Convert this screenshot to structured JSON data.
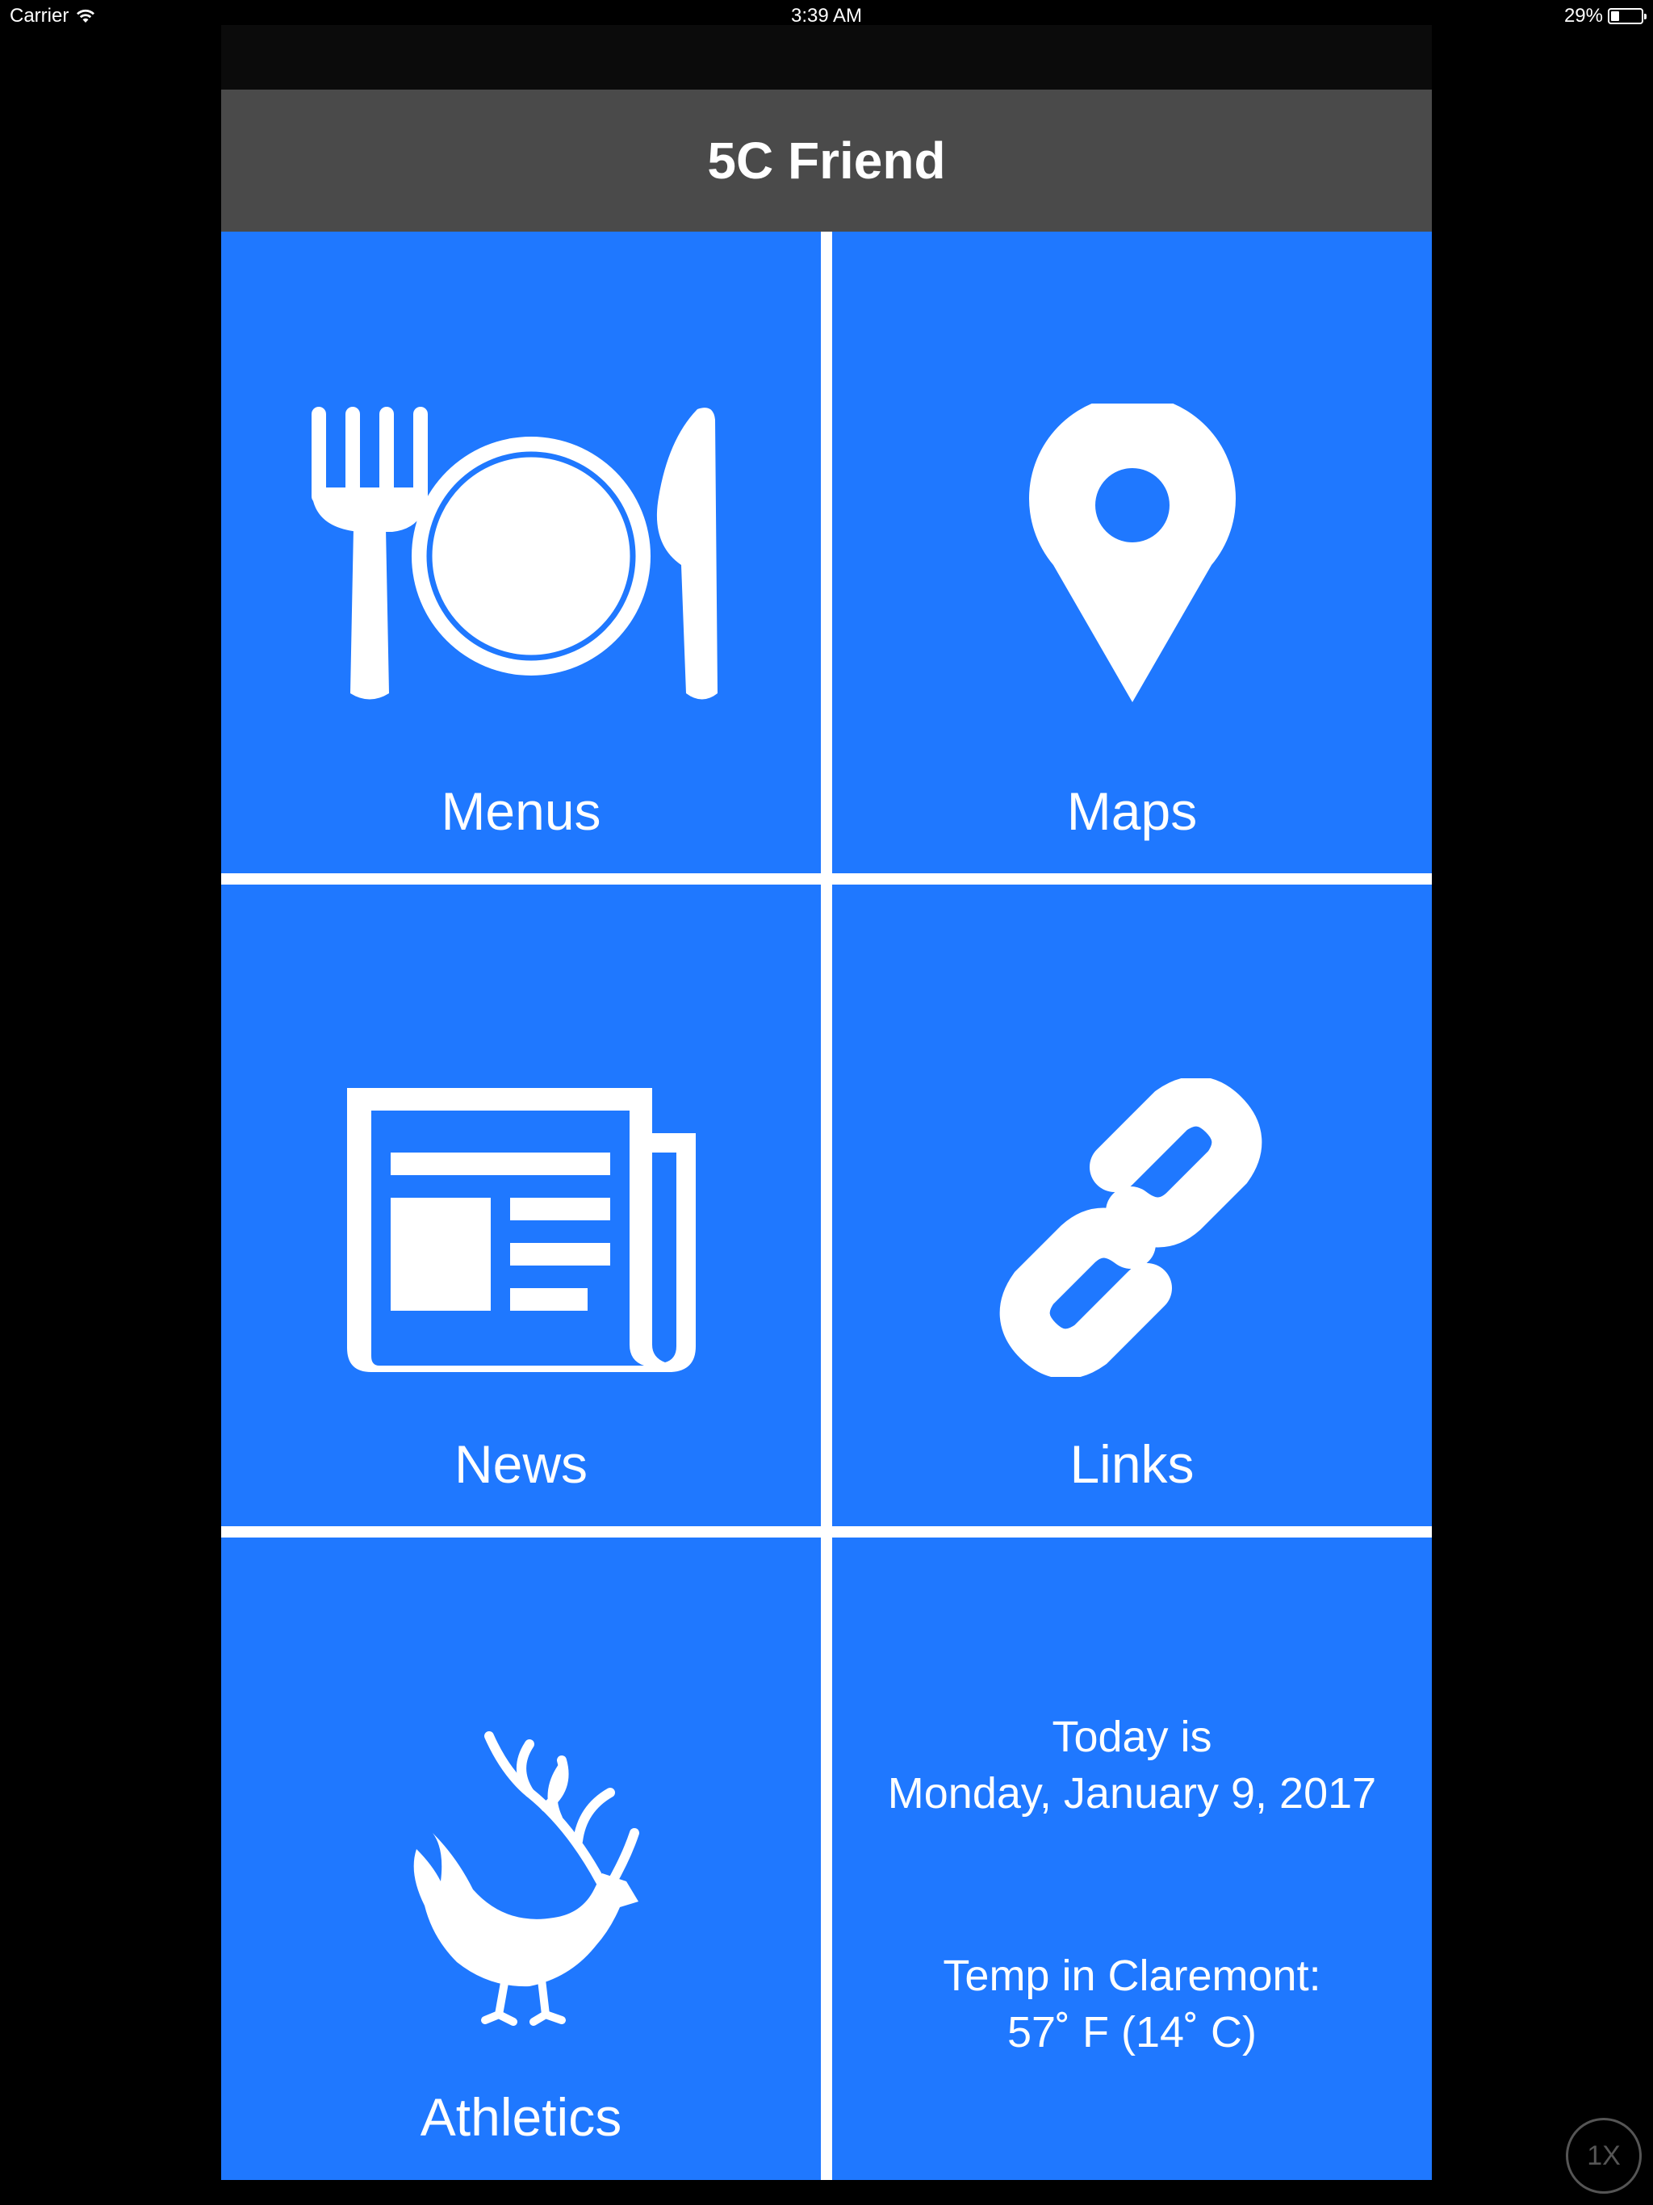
{
  "status_bar": {
    "carrier": "Carrier",
    "time": "3:39 AM",
    "battery_text": "29%",
    "battery_level": 0.29
  },
  "app": {
    "title": "5C Friend"
  },
  "tiles": {
    "menus": {
      "label": "Menus",
      "icon": "fork-plate-knife-icon"
    },
    "maps": {
      "label": "Maps",
      "icon": "map-pin-icon"
    },
    "news": {
      "label": "News",
      "icon": "newspaper-icon"
    },
    "links": {
      "label": "Links",
      "icon": "chain-link-icon"
    },
    "athletics": {
      "label": "Athletics",
      "icon": "stag-chicken-mascot-icon"
    },
    "info": {
      "today_label": "Today is",
      "date": "Monday, January 9, 2017",
      "temp_label": "Temp in Claremont:",
      "temp_value": "57˚ F (14˚ C)"
    }
  },
  "overlay": {
    "zoom_badge": "1X"
  },
  "colors": {
    "tile_blue": "#1f78ff",
    "nav_gray": "#4a4a4a",
    "background": "#000000"
  }
}
